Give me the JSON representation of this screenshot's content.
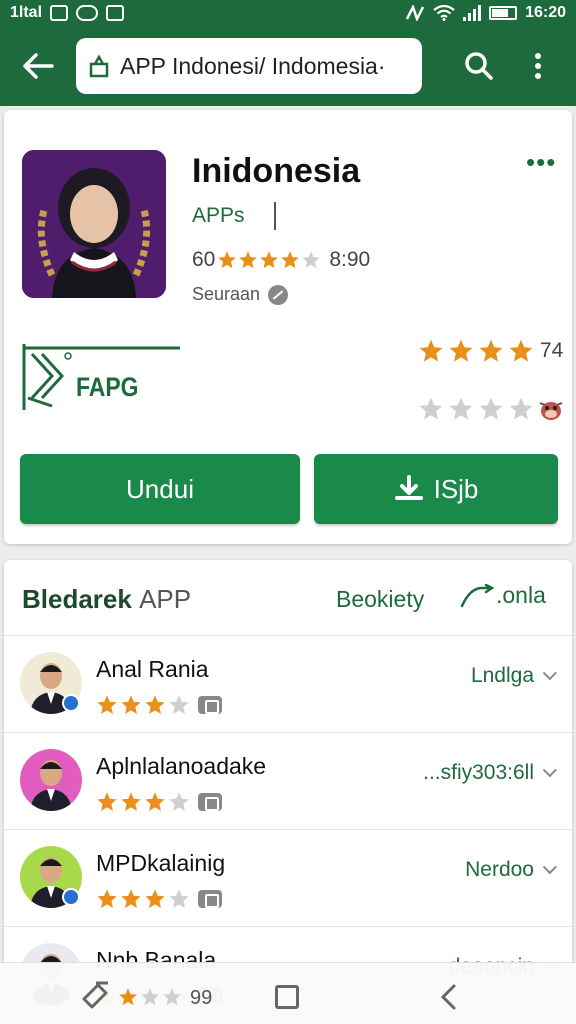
{
  "status_bar": {
    "left_text": "1ltal",
    "time": "16:20"
  },
  "app_bar": {
    "url": "APP Indonesi/ Indomesia·",
    "back_icon": "arrow-left-icon",
    "search_icon": "search-icon",
    "more_icon": "more-vert-icon"
  },
  "app": {
    "title": "Inidonesia",
    "category": "APPs",
    "rating_prefix": "60",
    "rating_stars": 4,
    "rating_suffix": "8:90",
    "developer": "Seuraan",
    "brand_text": "FAPG",
    "ratings_count": "74",
    "top_rating_stars": 4,
    "secondary_rating_stars": 0,
    "download_label": "Undui",
    "install_label": "ISjb",
    "accent_color": "#1a8a4a",
    "dark_green": "#1d6b3c",
    "star_color": "#e8901a"
  },
  "list_section": {
    "title": "Bledarek",
    "subtitle": "APP",
    "see_more": "Beokiety",
    "action_label": ".onla",
    "items": [
      {
        "name": "Anal Rania",
        "stars": 3,
        "action": "Lndlga",
        "avatar_bg": "#f1ead6",
        "has_badge": true
      },
      {
        "name": "Aplnlalanoadake",
        "stars": 3,
        "action": "...sfiy303:6ll",
        "avatar_bg": "#e35cc0",
        "has_badge": false
      },
      {
        "name": "MPDkalainig",
        "stars": 3,
        "action": "Nerdoo",
        "avatar_bg": "#a7d94a",
        "has_badge": true
      },
      {
        "name": "Nnb Banala",
        "stars": 2,
        "action": "deaoncin",
        "avatar_bg": "#e9e9ef",
        "has_badge": false
      }
    ]
  },
  "nav_bar": {
    "count": "99"
  }
}
